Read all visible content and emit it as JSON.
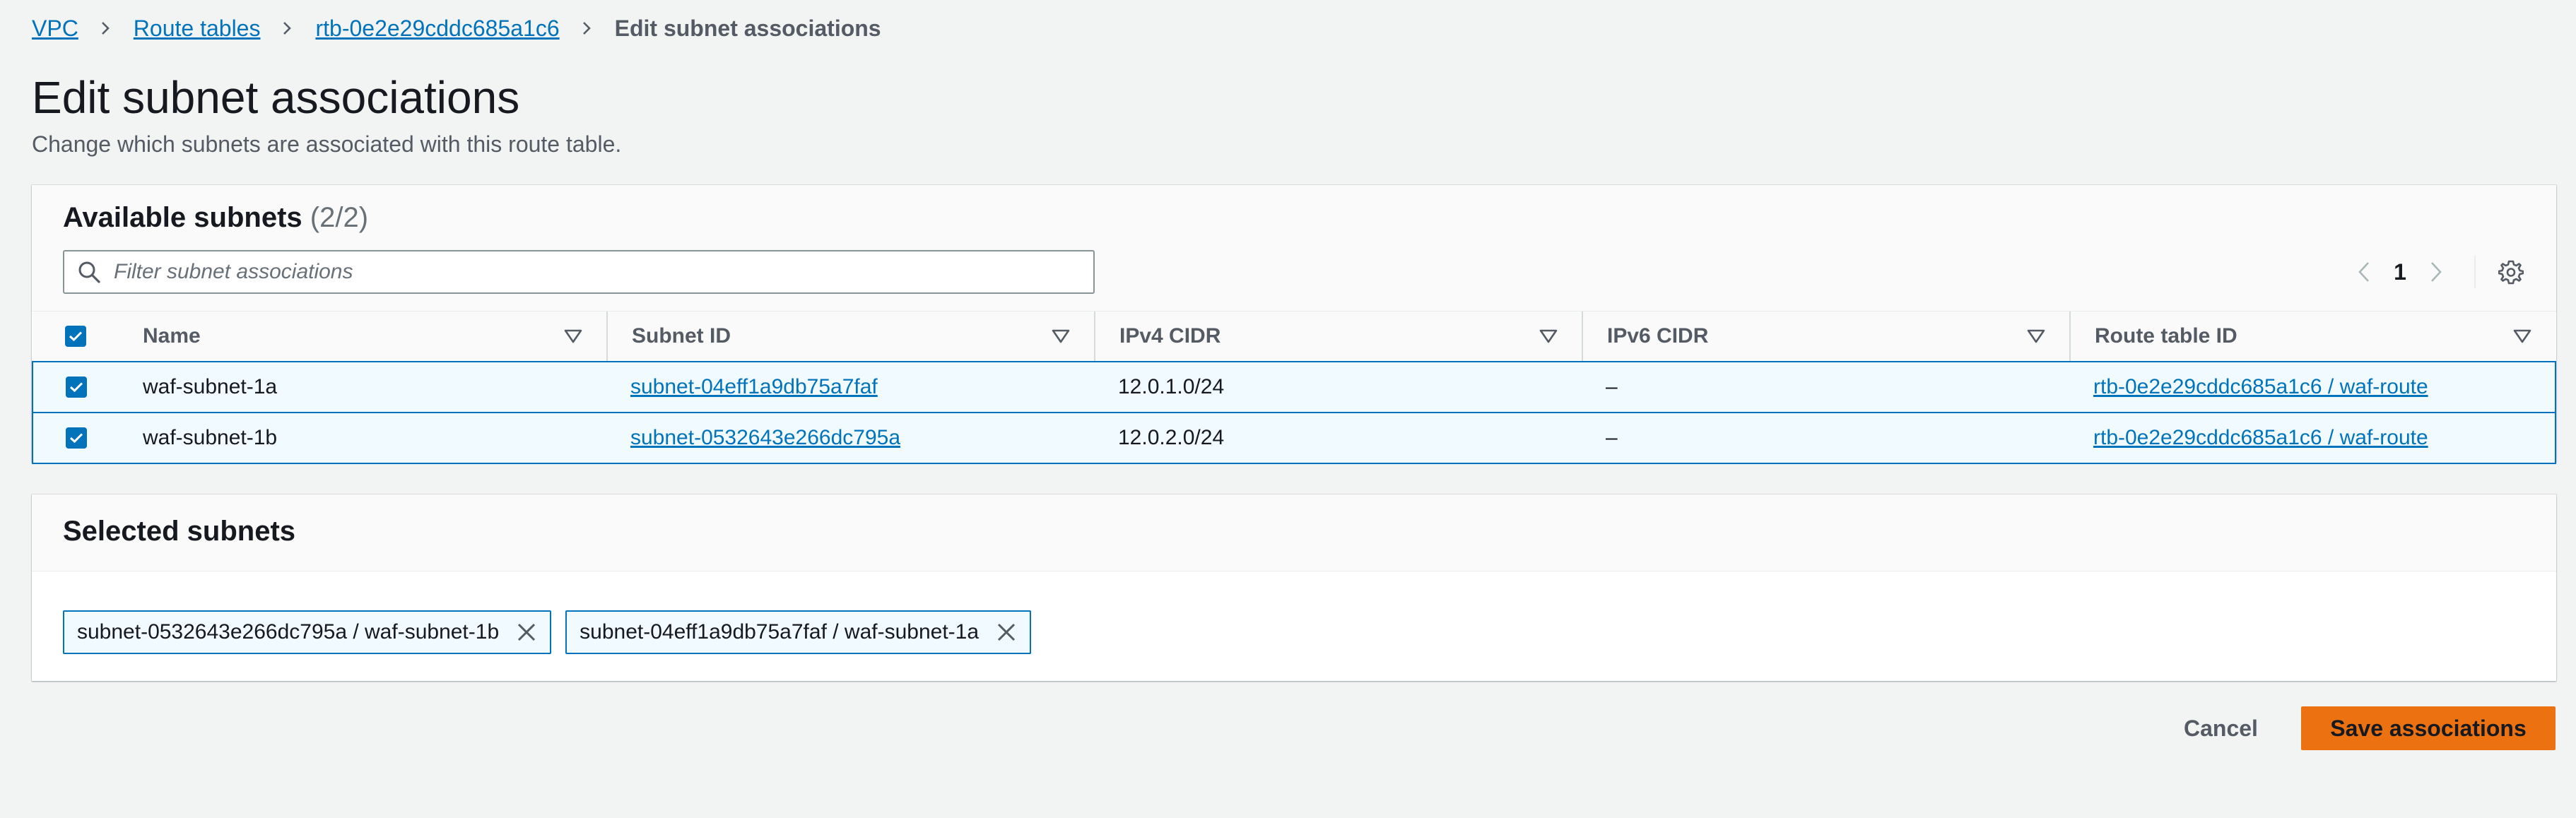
{
  "breadcrumb": {
    "items": [
      {
        "label": "VPC"
      },
      {
        "label": "Route tables"
      },
      {
        "label": "rtb-0e2e29cddc685a1c6"
      }
    ],
    "current": "Edit subnet associations"
  },
  "page": {
    "title": "Edit subnet associations",
    "description": "Change which subnets are associated with this route table."
  },
  "available": {
    "title": "Available subnets",
    "count": "(2/2)",
    "filter_placeholder": "Filter subnet associations",
    "page_number": "1",
    "columns": [
      "Name",
      "Subnet ID",
      "IPv4 CIDR",
      "IPv6 CIDR",
      "Route table ID"
    ],
    "rows": [
      {
        "checked": true,
        "name": "waf-subnet-1a",
        "subnet_id": "subnet-04eff1a9db75a7faf",
        "ipv4": "12.0.1.0/24",
        "ipv6": "–",
        "route_table": "rtb-0e2e29cddc685a1c6 / waf-route"
      },
      {
        "checked": true,
        "name": "waf-subnet-1b",
        "subnet_id": "subnet-0532643e266dc795a",
        "ipv4": "12.0.2.0/24",
        "ipv6": "–",
        "route_table": "rtb-0e2e29cddc685a1c6 / waf-route"
      }
    ]
  },
  "selected": {
    "title": "Selected subnets",
    "tokens": [
      {
        "label": "subnet-0532643e266dc795a / waf-subnet-1b"
      },
      {
        "label": "subnet-04eff1a9db75a7faf / waf-subnet-1a"
      }
    ]
  },
  "actions": {
    "cancel": "Cancel",
    "save": "Save associations"
  },
  "colors": {
    "link": "#0073bb",
    "primary_button": "#ec7211",
    "selected_row_bg": "#f1faff",
    "page_bg": "#f2f3f3"
  },
  "icons": [
    "chevron-right-icon",
    "search-icon",
    "chevron-left-icon",
    "settings-gear-icon",
    "sort-caret-icon",
    "checkbox-checked-icon",
    "close-icon"
  ]
}
